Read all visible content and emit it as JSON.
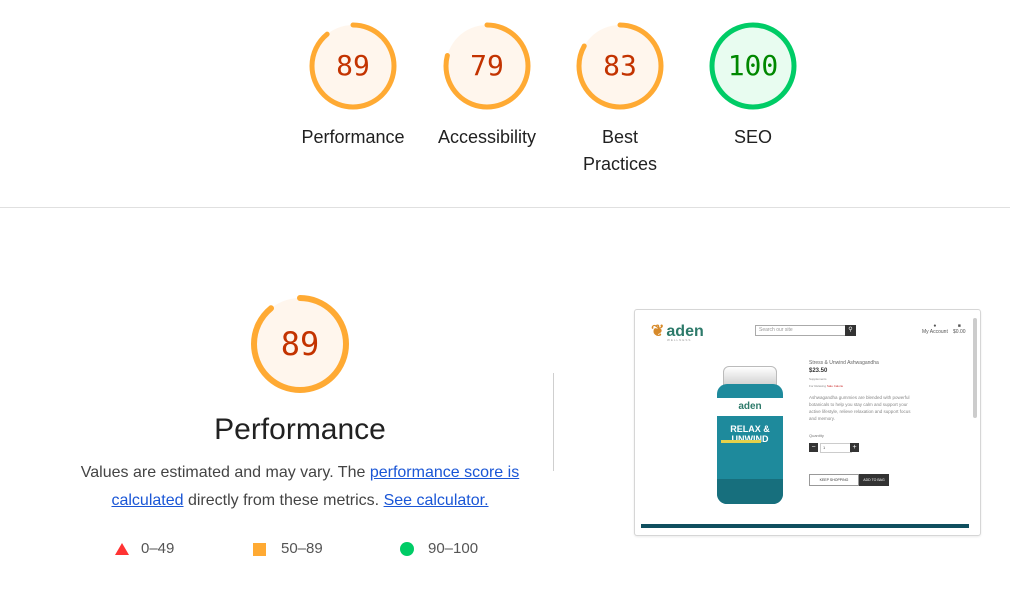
{
  "gauges": [
    {
      "score": "89",
      "label": "Performance",
      "value": 89,
      "color": "#ffaa33",
      "fill": "#fff6ed",
      "text_color": "#c33300"
    },
    {
      "score": "79",
      "label": "Accessibility",
      "value": 79,
      "color": "#ffaa33",
      "fill": "#fff6ed",
      "text_color": "#c33300"
    },
    {
      "score": "83",
      "label": "Best Practices",
      "value": 83,
      "color": "#ffaa33",
      "fill": "#fff6ed",
      "text_color": "#c33300"
    },
    {
      "score": "100",
      "label": "SEO",
      "value": 100,
      "color": "#00cc66",
      "fill": "#e8fcf0",
      "text_color": "#008800"
    }
  ],
  "performance": {
    "score": "89",
    "value": 89,
    "title": "Performance",
    "desc_prefix": "Values are estimated and may vary. The ",
    "perf_link": "performance score is calculated",
    "desc_mid": " directly from these metrics. ",
    "calc_link": "See calculator."
  },
  "legend": [
    {
      "range": "0–49",
      "color": "#ff3333"
    },
    {
      "range": "50–89",
      "color": "#ffaa33"
    },
    {
      "range": "90–100",
      "color": "#00cc66"
    }
  ],
  "screenshot": {
    "logo": "aden",
    "logo_sub": "WELLNESS",
    "search_placeholder": "Search our site",
    "account": "My Account",
    "cart": "$0.00",
    "product_title": "Stress & Unwind Ashwagandha",
    "price": "$23.50",
    "meta1": "Supplements",
    "meta2_a": "For Relaxing",
    "meta2_b": "Sale  Calorie",
    "description": "Ashwagandha gummies are blended with powerful botanicals to help you stay calm and support your active lifestyle, relieve relaxation and support focus and memory.",
    "qty_label": "Quantity",
    "qty_value": "1",
    "keep_shopping": "KEEP SHOPPING",
    "add_to_bag": "ADD TO BAG",
    "jar_logo": "aden",
    "jar_title": "RELAX & UNWIND"
  }
}
